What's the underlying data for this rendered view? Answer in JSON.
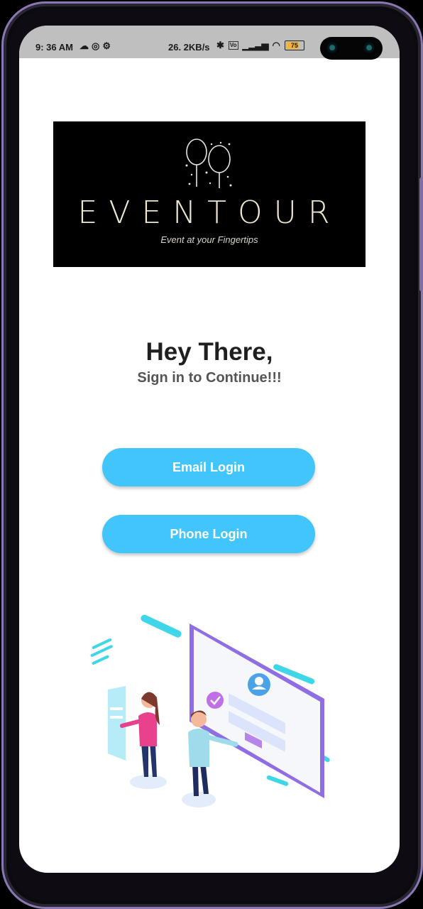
{
  "statusbar": {
    "time": "9: 36 AM",
    "speed": "26. 2KB/s",
    "battery": "75",
    "icons": [
      "cloud-icon",
      "sync-icon",
      "settings-icon",
      "bluetooth-icon",
      "volte-icon",
      "signal-icon",
      "wifi-icon",
      "battery-icon"
    ]
  },
  "logo": {
    "wordmark": "EVENTOUR",
    "tagline": "Event at your Fingertips"
  },
  "greeting": {
    "title": "Hey There,",
    "subtitle": "Sign in to Continue!!!"
  },
  "buttons": {
    "email_login": "Email Login",
    "phone_login": "Phone Login"
  },
  "colors": {
    "accent": "#42c5fb",
    "frame": "#8b78b3",
    "illustration_purple": "#8f6ee3",
    "illustration_cyan": "#3fd6e8",
    "illustration_pink": "#e8428c"
  }
}
